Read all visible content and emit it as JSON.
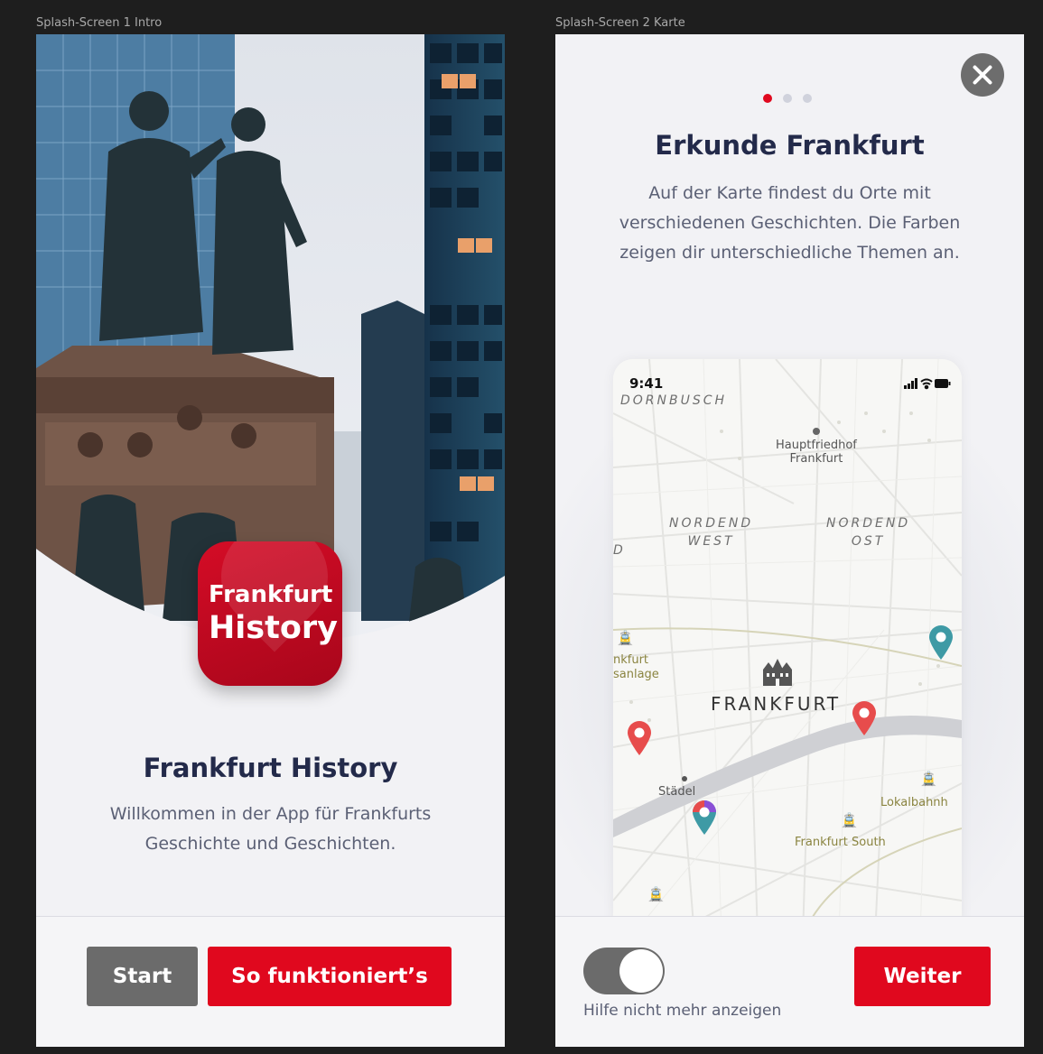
{
  "frames": [
    {
      "label": "Splash-Screen 1 Intro",
      "app_icon": {
        "line1": "Frankfurt",
        "line2": "History"
      },
      "title": "Frankfurt History",
      "description_line1": "Willkommen in der App für Frankfurts",
      "description_line2": "Geschichte und Geschichten.",
      "buttons": {
        "start": "Start",
        "how_it_works": "So funktioniert’s"
      }
    },
    {
      "label": "Splash-Screen 2 Karte",
      "pagination": {
        "total": 3,
        "active": 1
      },
      "title": "Erkunde Frankfurt",
      "description_line1": "Auf der Karte findest du Orte mit",
      "description_line2": "verschiedenen Geschichten. Die Farben",
      "description_line3": "zeigen dir unterschiedliche Themen an.",
      "phone": {
        "time": "9:41",
        "map_labels": {
          "dornbusch": "DORNBUSCH",
          "hauptfriedhof_1": "Hauptfriedhof",
          "hauptfriedhof_2": "Frankfurt",
          "nordend_west_1": "NORDEND",
          "nordend_west_2": "WEST",
          "nordend_ost_1": "NORDEND",
          "nordend_ost_2": "OST",
          "edge_d": "D",
          "anlage_1": "nkfurt",
          "anlage_2": "sanlage",
          "city": "FRANKFURT",
          "staedel": "Städel",
          "lokalbahnhof": "Lokalbahnh",
          "frankfurt_south": "Frankfurt South"
        }
      },
      "toggle": {
        "label": "Hilfe nicht mehr anzeigen",
        "on": true
      },
      "buttons": {
        "next": "Weiter"
      }
    }
  ],
  "colors": {
    "primary_red": "#e0081e",
    "dark_navy": "#232a4a",
    "gray_button": "#6b6b6b",
    "pin_red": "#e74c4c",
    "pin_teal": "#3e9aa5",
    "pin_purple": "#8a4fd6"
  },
  "icons": [
    "close-icon",
    "signal-icon",
    "wifi-icon",
    "battery-icon",
    "map-pin-icon",
    "train-icon",
    "building-icon"
  ]
}
